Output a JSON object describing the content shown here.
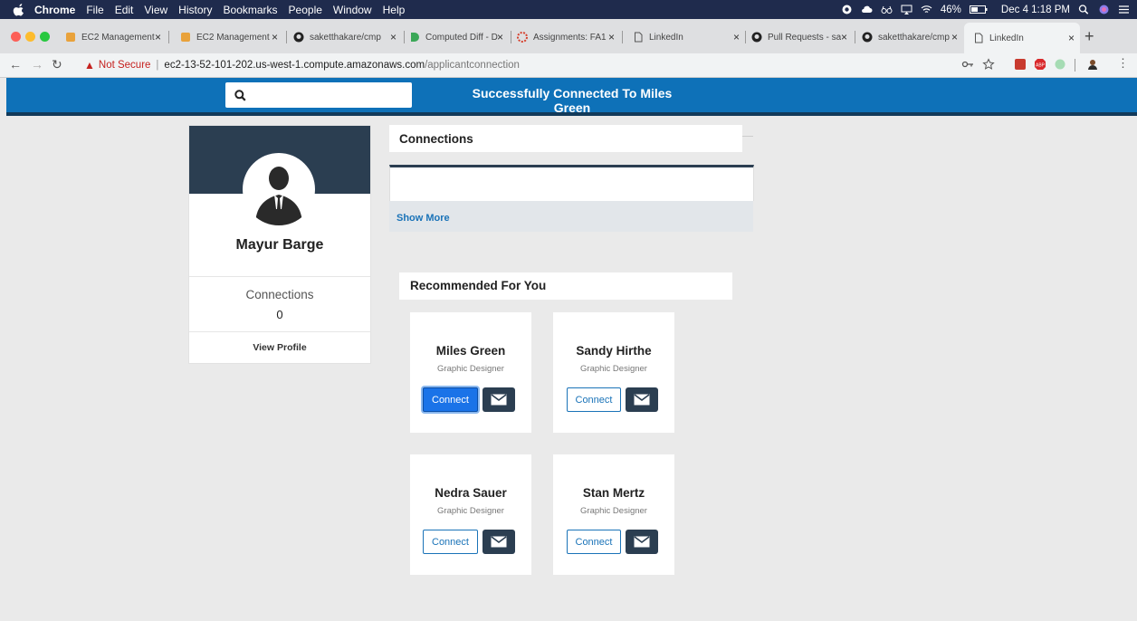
{
  "menubar": {
    "items": [
      "Chrome",
      "File",
      "Edit",
      "View",
      "History",
      "Bookmarks",
      "People",
      "Window",
      "Help"
    ],
    "battery": "46%",
    "datetime": "Dec 4  1:18 PM"
  },
  "tabs": [
    {
      "label": "EC2 Management",
      "icon": "aws-cube-icon"
    },
    {
      "label": "EC2 Management",
      "icon": "aws-cube-icon"
    },
    {
      "label": "saketthakare/cmp",
      "icon": "github-icon"
    },
    {
      "label": "Computed Diff - D",
      "icon": "diff-icon"
    },
    {
      "label": "Assignments: FA1",
      "icon": "canvas-icon"
    },
    {
      "label": "LinkedIn",
      "icon": "page-icon"
    },
    {
      "label": "Pull Requests - sa",
      "icon": "github-icon"
    },
    {
      "label": "saketthakare/cmp",
      "icon": "github-icon"
    },
    {
      "label": "LinkedIn",
      "icon": "page-icon"
    }
  ],
  "address": {
    "security": "Not Secure",
    "host": "ec2-13-52-101-202.us-west-1.compute.amazonaws.com",
    "path": "/applicantconnection"
  },
  "app": {
    "status_message": "Successfully Connected To Miles Green",
    "profile": {
      "name": "Mayur Barge",
      "connections_label": "Connections",
      "connections_count": "0",
      "view_profile": "View Profile"
    },
    "connections": {
      "title": "Connections",
      "show_more": "Show More"
    },
    "recommended": {
      "title": "Recommended For You",
      "connect_label": "Connect",
      "people": [
        {
          "name": "Miles Green",
          "role": "Graphic Designer"
        },
        {
          "name": "Sandy Hirthe",
          "role": "Graphic Designer"
        },
        {
          "name": "Nedra Sauer",
          "role": "Graphic Designer"
        },
        {
          "name": "Stan Mertz",
          "role": "Graphic Designer"
        }
      ]
    }
  },
  "colors": {
    "topbar": "#0e71b8",
    "dark": "#2b3e51",
    "link": "#1a73b8",
    "primary_button": "#1a73e8"
  }
}
